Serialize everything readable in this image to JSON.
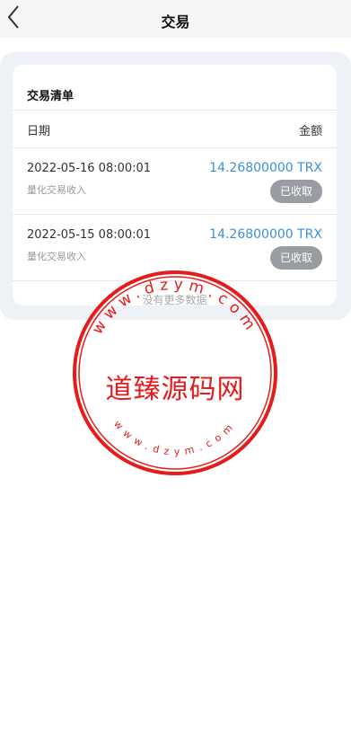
{
  "header": {
    "title": "交易",
    "back_icon": "chevron-left-icon"
  },
  "card": {
    "title": "交易清单",
    "columns": {
      "date": "日期",
      "amount": "金额"
    },
    "rows": [
      {
        "date": "2022-05-16 08:00:01",
        "desc": "量化交易收入",
        "amount": "14.26800000 TRX",
        "status": "已收取"
      },
      {
        "date": "2022-05-15 08:00:01",
        "desc": "量化交易收入",
        "amount": "14.26800000 TRX",
        "status": "已收取"
      }
    ],
    "no_more": "没有更多数据"
  },
  "watermark": {
    "text": "道臻源码网",
    "top_arc": "www.dzym.com",
    "bottom_arc": "www.dzym.com",
    "color": "#e51c1c"
  },
  "colors": {
    "amount": "#3b8fd6",
    "status_button": "#999ca3",
    "panel_bg": "#eef1f6"
  }
}
